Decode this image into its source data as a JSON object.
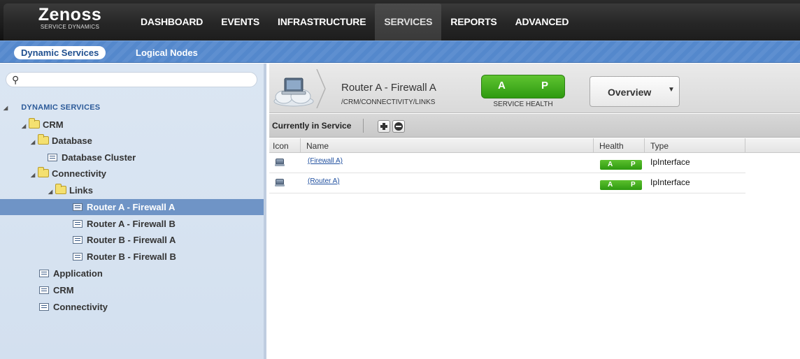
{
  "app": {
    "logo_main": "Zenoss",
    "logo_sub": "Service Dynamics"
  },
  "nav": {
    "items": [
      {
        "label": "DASHBOARD"
      },
      {
        "label": "EVENTS"
      },
      {
        "label": "INFRASTRUCTURE"
      },
      {
        "label": "SERVICES",
        "active": true
      },
      {
        "label": "REPORTS"
      },
      {
        "label": "ADVANCED"
      }
    ]
  },
  "subnav": {
    "items": [
      {
        "label": "Dynamic Services",
        "active": true
      },
      {
        "label": "Logical Nodes"
      }
    ]
  },
  "tree": {
    "search_placeholder": "",
    "heading": "DYNAMIC SERVICES",
    "nodes": [
      {
        "label": "CRM"
      },
      {
        "label": "Database"
      },
      {
        "label": "Database Cluster"
      },
      {
        "label": "Connectivity"
      },
      {
        "label": "Links"
      },
      {
        "label": "Router A - Firewall A",
        "selected": true
      },
      {
        "label": "Router A - Firewall B"
      },
      {
        "label": "Router B - Firewall A"
      },
      {
        "label": "Router B - Firewall B"
      },
      {
        "label": "Application"
      },
      {
        "label": "CRM"
      },
      {
        "label": "Connectivity"
      }
    ]
  },
  "service": {
    "title": "Router A - Firewall A",
    "path": "/CRM/CONNECTIVITY/LINKS",
    "health_a": "A",
    "health_p": "P",
    "health_label": "SERVICE HEALTH",
    "overview_label": "Overview"
  },
  "toolbar": {
    "label": "Currently in Service"
  },
  "grid": {
    "columns": {
      "icon": "Icon",
      "name": "Name",
      "health": "Health",
      "type": "Type"
    },
    "rows": [
      {
        "name": "(Firewall A)",
        "health_a": "A",
        "health_p": "P",
        "type": "IpInterface"
      },
      {
        "name": "(Router A)",
        "health_a": "A",
        "health_p": "P",
        "type": "IpInterface"
      }
    ]
  },
  "colors": {
    "nav_bg": "#262626",
    "subnav_bg": "#5a8cce",
    "tree_bg": "#d6e2f0",
    "selected_row": "#6f94c6",
    "health_green": "#3aa81a",
    "link": "#1f4f9f"
  }
}
